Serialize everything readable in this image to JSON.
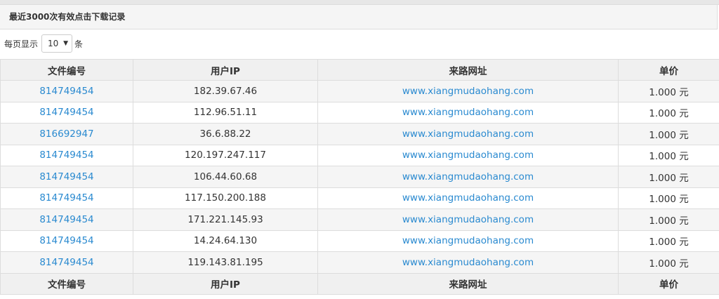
{
  "panel": {
    "title": "最近3000次有效点击下载记录"
  },
  "length_menu": {
    "prefix": "每页显示",
    "value": "10",
    "suffix": "条"
  },
  "table": {
    "headers": [
      "文件编号",
      "用户IP",
      "来路网址",
      "单价"
    ],
    "rows": [
      {
        "file_id": "814749454",
        "ip": "182.39.67.46",
        "referrer": "www.xiangmudaohang.com",
        "price": "1.000 元"
      },
      {
        "file_id": "814749454",
        "ip": "112.96.51.11",
        "referrer": "www.xiangmudaohang.com",
        "price": "1.000 元"
      },
      {
        "file_id": "816692947",
        "ip": "36.6.88.22",
        "referrer": "www.xiangmudaohang.com",
        "price": "1.000 元"
      },
      {
        "file_id": "814749454",
        "ip": "120.197.247.117",
        "referrer": "www.xiangmudaohang.com",
        "price": "1.000 元"
      },
      {
        "file_id": "814749454",
        "ip": "106.44.60.68",
        "referrer": "www.xiangmudaohang.com",
        "price": "1.000 元"
      },
      {
        "file_id": "814749454",
        "ip": "117.150.200.188",
        "referrer": "www.xiangmudaohang.com",
        "price": "1.000 元"
      },
      {
        "file_id": "814749454",
        "ip": "171.221.145.93",
        "referrer": "www.xiangmudaohang.com",
        "price": "1.000 元"
      },
      {
        "file_id": "814749454",
        "ip": "14.24.64.130",
        "referrer": "www.xiangmudaohang.com",
        "price": "1.000 元"
      },
      {
        "file_id": "814749454",
        "ip": "119.143.81.195",
        "referrer": "www.xiangmudaohang.com",
        "price": "1.000 元"
      }
    ]
  },
  "icons": {
    "select_arrow": "chevron-down-icon"
  },
  "colors": {
    "link": "#2a8ad0",
    "header_bg": "#f0f0f0",
    "stripe": "#f5f5f5",
    "border": "#dddddd"
  }
}
